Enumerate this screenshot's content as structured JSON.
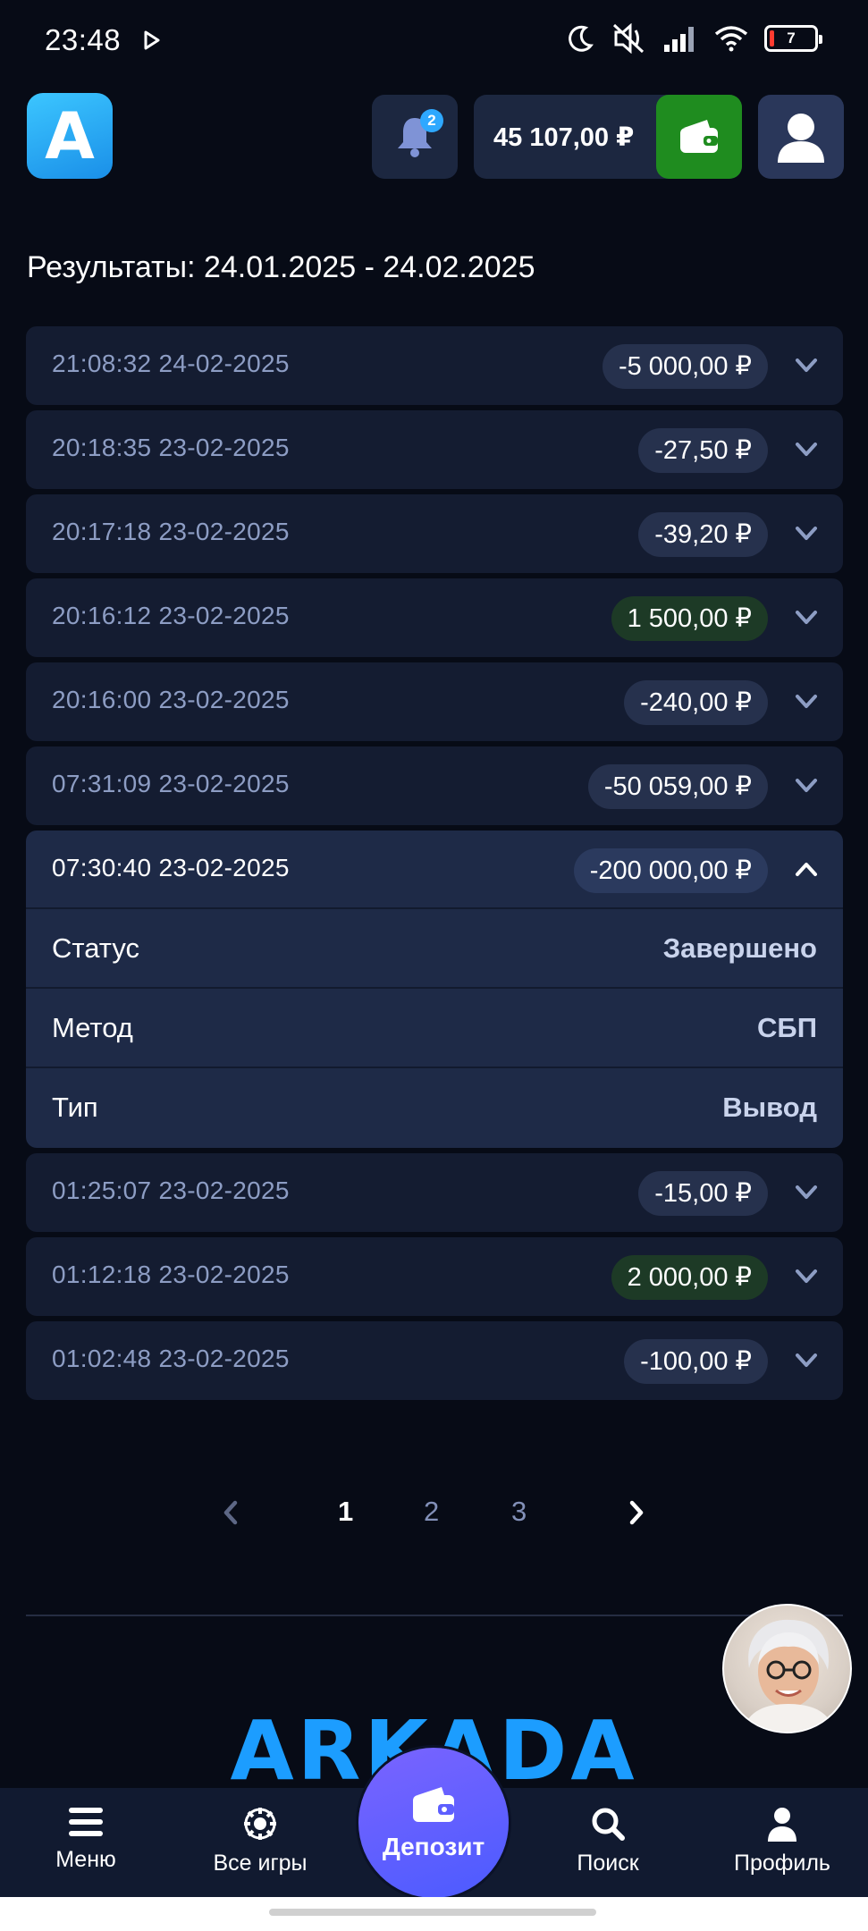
{
  "status_bar": {
    "time": "23:48",
    "battery": "7",
    "icons": [
      "play-icon",
      "moon-icon",
      "mute-icon",
      "signal-icon",
      "wifi-icon",
      "battery-icon"
    ]
  },
  "header": {
    "logo_letter": "A",
    "notifications_count": "2",
    "balance": "45 107,00 ₽",
    "colors": {
      "wallet": "#1f8c1f",
      "logo": "#1a8fe8",
      "badge": "#2ea8ff"
    }
  },
  "results": {
    "title": "Результаты: 24.01.2025 - 24.02.2025"
  },
  "transactions": [
    {
      "datetime": "21:08:32 24-02-2025",
      "amount": "-5 000,00 ₽",
      "positive": false
    },
    {
      "datetime": "20:18:35 23-02-2025",
      "amount": "-27,50 ₽",
      "positive": false
    },
    {
      "datetime": "20:17:18 23-02-2025",
      "amount": "-39,20 ₽",
      "positive": false
    },
    {
      "datetime": "20:16:12 23-02-2025",
      "amount": "1 500,00 ₽",
      "positive": true
    },
    {
      "datetime": "20:16:00 23-02-2025",
      "amount": "-240,00 ₽",
      "positive": false
    },
    {
      "datetime": "07:31:09 23-02-2025",
      "amount": "-50 059,00 ₽",
      "positive": false
    }
  ],
  "expanded_transaction": {
    "datetime": "07:30:40 23-02-2025",
    "amount": "-200 000,00 ₽",
    "details": [
      {
        "key": "Статус",
        "value": "Завершено"
      },
      {
        "key": "Метод",
        "value": "СБП"
      },
      {
        "key": "Тип",
        "value": "Вывод"
      }
    ]
  },
  "transactions_after": [
    {
      "datetime": "01:25:07 23-02-2025",
      "amount": "-15,00 ₽",
      "positive": false
    },
    {
      "datetime": "01:12:18 23-02-2025",
      "amount": "2 000,00 ₽",
      "positive": true
    },
    {
      "datetime": "01:02:48 23-02-2025",
      "amount": "-100,00 ₽",
      "positive": false
    }
  ],
  "pagination": {
    "pages": [
      "1",
      "2",
      "3"
    ],
    "current": "1"
  },
  "brand": "ARKADA",
  "bottom_nav": {
    "menu": "Меню",
    "all_games": "Все игры",
    "deposit": "Депозит",
    "search": "Поиск",
    "profile": "Профиль"
  }
}
